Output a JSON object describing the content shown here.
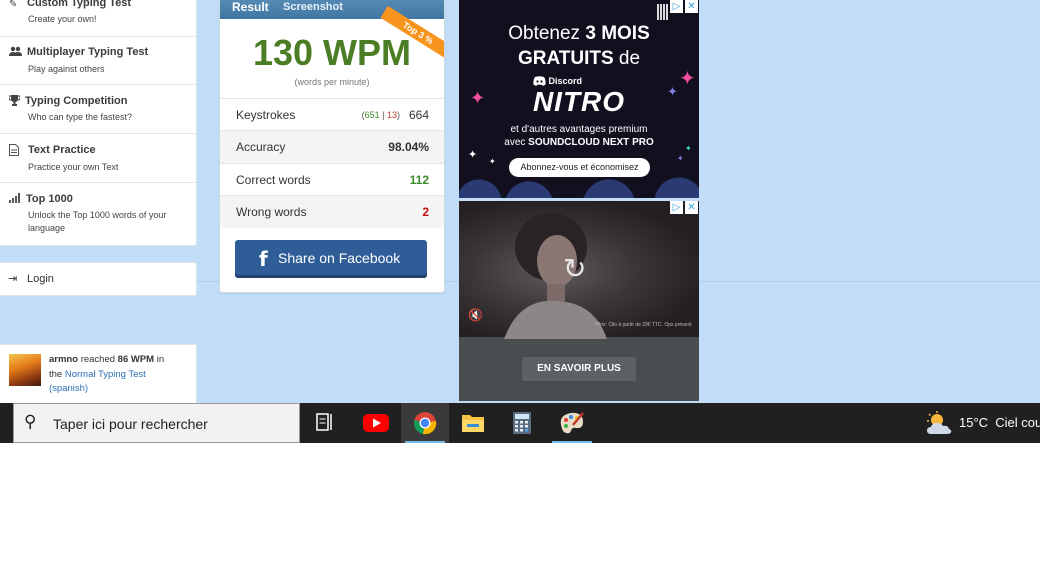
{
  "menu": {
    "items": [
      {
        "title": "Custom Typing Test",
        "desc": "Create your own!"
      },
      {
        "title": "Multiplayer Typing Test",
        "desc": "Play against others"
      },
      {
        "title": "Typing Competition",
        "desc": "Who can type the fastest?"
      },
      {
        "title": "Text Practice",
        "desc": "Practice your own Text"
      },
      {
        "title": "Top 1000",
        "desc": "Unlock the Top 1000 words of your language"
      }
    ],
    "login": "Login"
  },
  "feed": {
    "user": "armno",
    "reached": "reached",
    "wpm": "86 WPM",
    "in": "in",
    "the": "the",
    "test": "Normal Typing Test",
    "lang": "(spanish)"
  },
  "result": {
    "tab_result": "Result",
    "tab_screenshot": "Screenshot",
    "ribbon": "Top 3 %",
    "wpm": "130 WPM",
    "wpm_sub": "(words per minute)",
    "keystrokes": {
      "label": "Keystrokes",
      "correct": "651",
      "sep": "|",
      "wrong": "13",
      "total": "664"
    },
    "accuracy": {
      "label": "Accuracy",
      "value": "98.04%"
    },
    "correct_words": {
      "label": "Correct words",
      "value": "112"
    },
    "wrong_words": {
      "label": "Wrong words",
      "value": "2"
    },
    "share": "Share on Facebook"
  },
  "ad1": {
    "line1_pre": "Obtenez",
    "line1_bold": "3 MOIS",
    "line2_bold": "GRATUITS",
    "line2_rest": "de",
    "brand": "Discord",
    "product": "NITRO",
    "line3": "et d'autres avantages premium",
    "line4_pre": "avec",
    "line4_bold": "SOUNDCLOUD NEXT PRO",
    "cta": "Abonnez-vous et économisez"
  },
  "ad2": {
    "fine_print": "*Prix: Clio à partir de 29€ TTC. Ops présent",
    "cta": "EN SAVOIR PLUS"
  },
  "taskbar": {
    "search_placeholder": "Taper ici pour rechercher",
    "weather_temp": "15°C",
    "weather_desc": "Ciel couvert"
  },
  "colors": {
    "page_bg": "#c2ddf7",
    "wpm_green": "#4b7d25",
    "facebook_blue": "#2f5d97",
    "ribbon_orange": "#f7941d",
    "correct_green": "#3a8a2a",
    "wrong_red": "#cc1111"
  }
}
